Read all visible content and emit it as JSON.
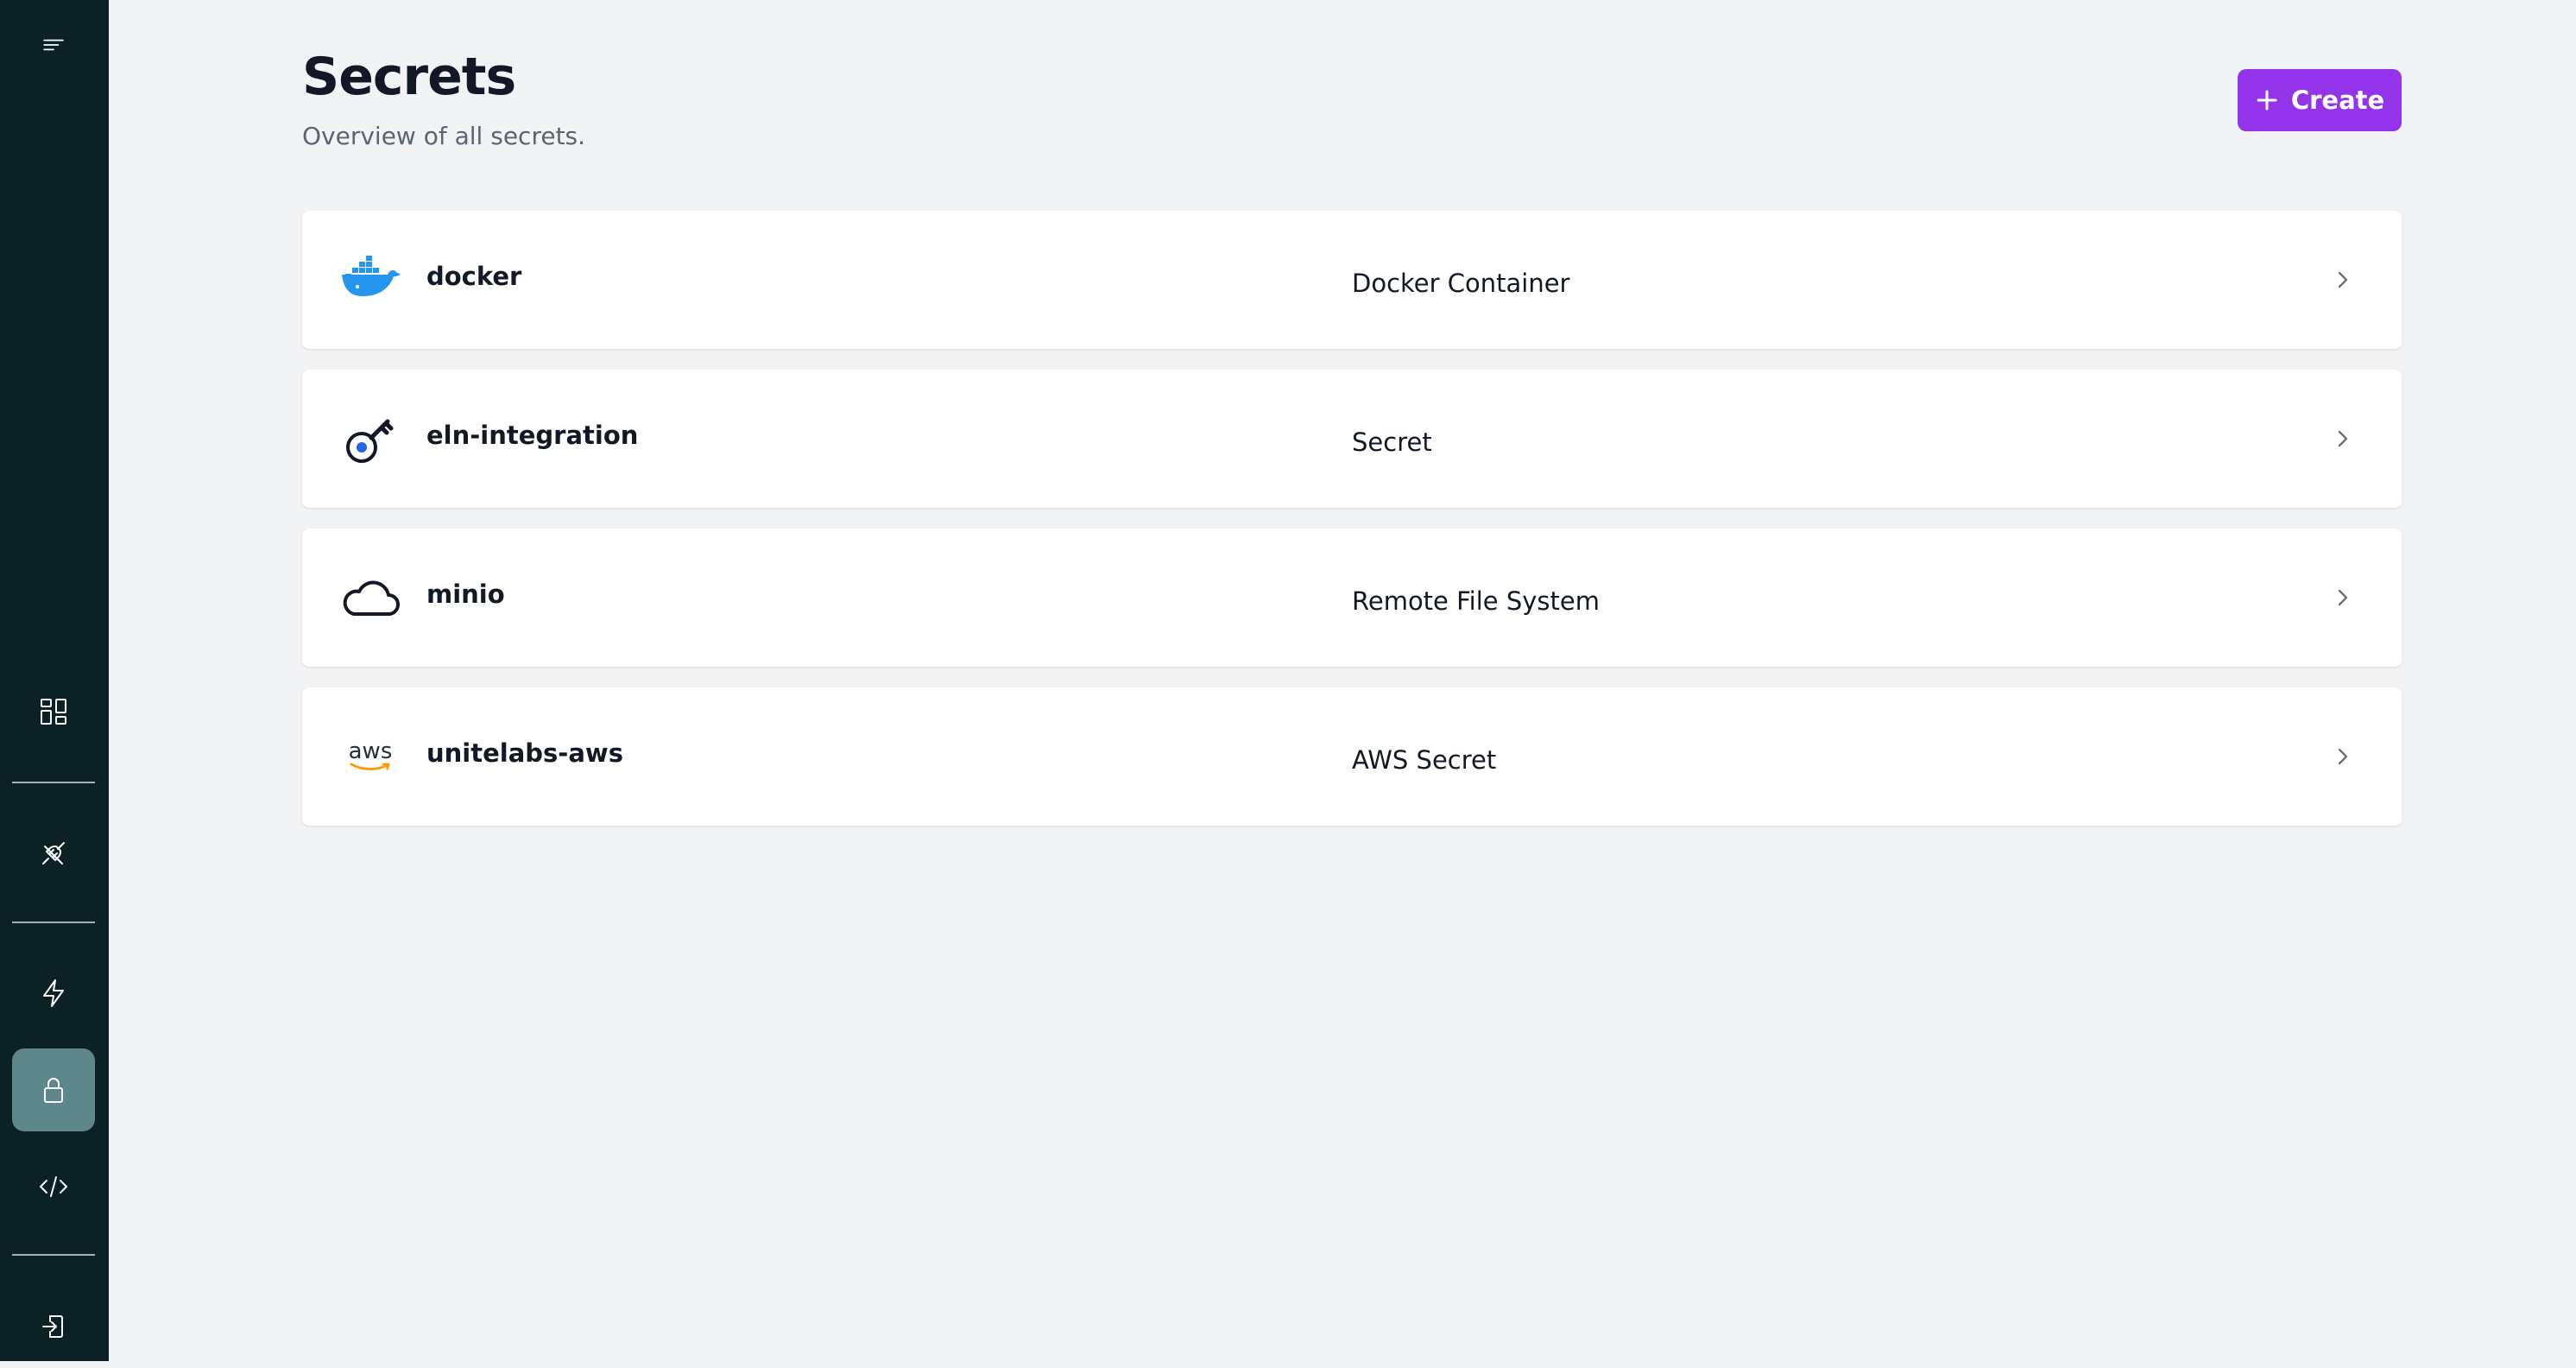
{
  "sidebar": {
    "items": [
      {
        "name": "menu",
        "icon": "menu-icon"
      },
      {
        "name": "dashboard",
        "icon": "dashboard-grid-icon"
      },
      {
        "name": "connections",
        "icon": "plug-icon"
      },
      {
        "name": "automations",
        "icon": "lightning-icon"
      },
      {
        "name": "secrets",
        "icon": "lock-icon",
        "active": true
      },
      {
        "name": "developer",
        "icon": "code-icon"
      },
      {
        "name": "logout",
        "icon": "logout-icon"
      }
    ],
    "active_color": "#5e878c",
    "background_color": "#0c2126"
  },
  "header": {
    "title": "Secrets",
    "subtitle": "Overview of all secrets.",
    "create_label": "Create",
    "create_color": "#9333ea"
  },
  "secrets": [
    {
      "name": "docker",
      "type": "Docker Container",
      "icon": "docker-icon"
    },
    {
      "name": "eln-integration",
      "type": "Secret",
      "icon": "key-icon"
    },
    {
      "name": "minio",
      "type": "Remote File System",
      "icon": "cloud-icon"
    },
    {
      "name": "unitelabs-aws",
      "type": "AWS Secret",
      "icon": "aws-icon",
      "icon_text": "aws"
    }
  ]
}
